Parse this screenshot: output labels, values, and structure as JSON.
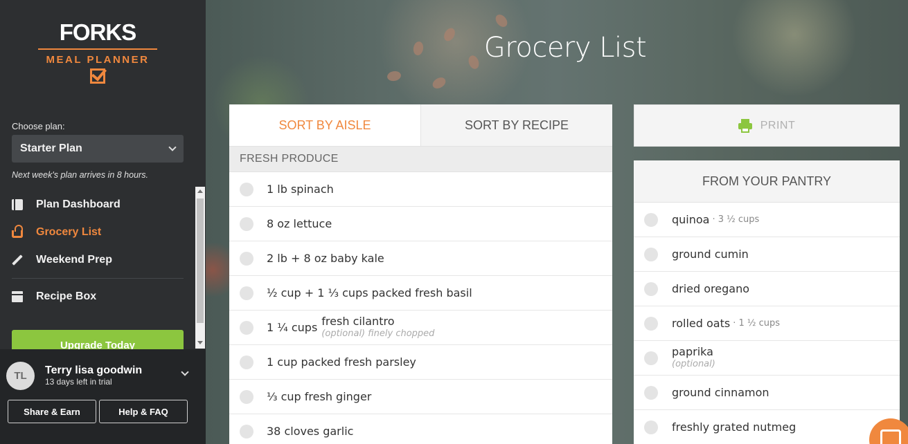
{
  "brand": {
    "name": "FORKS",
    "subtitle": "MEAL PLANNER"
  },
  "sidebar": {
    "choose_plan_label": "Choose plan:",
    "selected_plan": "Starter Plan",
    "next_week_note": "Next week's plan arrives in 8 hours.",
    "nav": [
      {
        "label": "Plan Dashboard",
        "icon": "dashboard-icon"
      },
      {
        "label": "Grocery List",
        "icon": "basket-icon",
        "active": true
      },
      {
        "label": "Weekend Prep",
        "icon": "pencil-icon"
      },
      {
        "label": "Recipe Box",
        "icon": "recipe-box-icon"
      }
    ],
    "upgrade_label": "Upgrade Today"
  },
  "user": {
    "initials": "TL",
    "name": "Terry lisa goodwin",
    "trial": "13 days left in trial",
    "share_label": "Share & Earn",
    "help_label": "Help & FAQ"
  },
  "page": {
    "title": "Grocery List"
  },
  "tabs": {
    "by_aisle": "SORT BY AISLE",
    "by_recipe": "SORT BY RECIPE"
  },
  "aisle": "FRESH PRODUCE",
  "items": [
    {
      "text": "1 lb spinach"
    },
    {
      "text": "8 oz lettuce"
    },
    {
      "text": "2 lb + 8 oz baby kale"
    },
    {
      "text": "½ cup + 1 ⅓ cups packed fresh basil"
    },
    {
      "text": "1 ¼ cups",
      "name": "fresh cilantro",
      "note": "(optional) finely chopped"
    },
    {
      "text": "1 cup packed fresh parsley"
    },
    {
      "text": "⅓ cup fresh ginger"
    },
    {
      "text": "38 cloves garlic"
    }
  ],
  "print_label": "PRINT",
  "pantry": {
    "title": "FROM YOUR PANTRY",
    "items": [
      {
        "name": "quinoa",
        "qty": "· 3 ½ cups"
      },
      {
        "name": "ground cumin"
      },
      {
        "name": "dried oregano"
      },
      {
        "name": "rolled oats",
        "qty": "· 1 ½ cups"
      },
      {
        "name": "paprika",
        "note": "(optional)"
      },
      {
        "name": "ground cinnamon"
      },
      {
        "name": "freshly grated nutmeg"
      }
    ]
  },
  "colors": {
    "accent": "#f0883e",
    "green": "#8cc63f",
    "sidebar": "#2d2f31"
  }
}
